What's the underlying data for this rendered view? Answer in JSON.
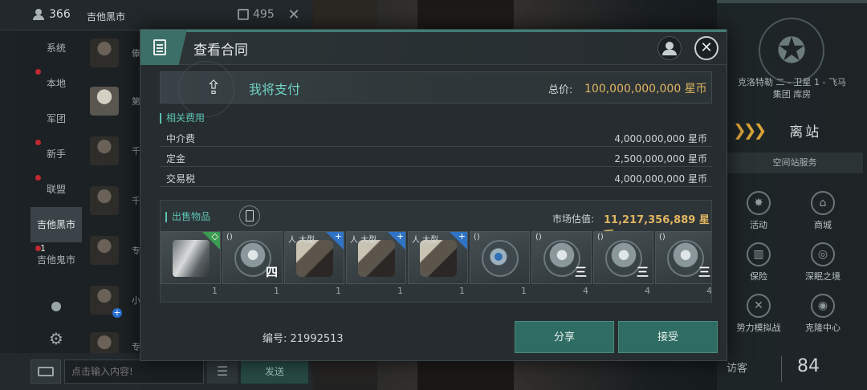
{
  "chat": {
    "online_count": "366",
    "channel_name": "吉他黑市",
    "member_count": "495",
    "tabs": [
      {
        "label": "系统",
        "dot": false
      },
      {
        "label": "本地",
        "dot": true
      },
      {
        "label": "军团",
        "dot": false
      },
      {
        "label": "新手",
        "dot": true
      },
      {
        "label": "联盟",
        "dot": true
      },
      {
        "label": "吉他黑市",
        "dot": false,
        "active": true
      },
      {
        "label": "吉他鬼市",
        "dot": true,
        "badge": "1"
      }
    ],
    "avatar_names": [
      "傣",
      "第",
      "千",
      "千",
      "专",
      "小",
      "专"
    ],
    "input_placeholder": "点击输入内容!",
    "send_label": "发送"
  },
  "modal": {
    "title": "查看合同",
    "pay_label": "我将支付",
    "total_label": "总价:",
    "total_value": "100,000,000,000 星币",
    "fees_title": "相关费用",
    "fees": [
      {
        "label": "中介费",
        "value": "4,000,000,000 星币"
      },
      {
        "label": "定金",
        "value": "2,500,000,000 星币"
      },
      {
        "label": "交易税",
        "value": "4,000,000,000 星币"
      }
    ],
    "items_title": "出售物品",
    "market_label": "市场估值:",
    "market_value": "11,217,356,889 星币",
    "items": [
      {
        "art": "drone",
        "tag": "",
        "flag": "green",
        "flag_glyph": "◇",
        "tier": "",
        "count": "1"
      },
      {
        "art": "shield",
        "tag": "()",
        "flag": "",
        "flag_glyph": "",
        "tier": "四",
        "count": "1"
      },
      {
        "art": "gun",
        "tag": "人 大型",
        "flag": "blue",
        "flag_glyph": "+",
        "tier": "",
        "count": "1"
      },
      {
        "art": "gun",
        "tag": "人 大型",
        "flag": "blue",
        "flag_glyph": "+",
        "tier": "",
        "count": "1"
      },
      {
        "art": "gun",
        "tag": "人 大型",
        "flag": "blue",
        "flag_glyph": "+",
        "tier": "",
        "count": "1"
      },
      {
        "art": "orb",
        "tag": "()",
        "flag": "",
        "flag_glyph": "",
        "tier": "",
        "count": "1"
      },
      {
        "art": "shield",
        "tag": "()",
        "flag": "",
        "flag_glyph": "",
        "tier": "三",
        "count": "4"
      },
      {
        "art": "shield",
        "tag": "()",
        "flag": "",
        "flag_glyph": "",
        "tier": "三",
        "count": "4"
      },
      {
        "art": "shield",
        "tag": "()",
        "flag": "",
        "flag_glyph": "",
        "tier": "三",
        "count": "4"
      }
    ],
    "contract_no": "编号: 21992513",
    "share_label": "分享",
    "accept_label": "接受"
  },
  "station": {
    "name_line1": "克洛特勒 二 - 卫星 1 - 飞马",
    "name_line2": "集团 库房",
    "undock_label": "离站",
    "services_title": "空间站服务",
    "services": [
      "活动",
      "商城",
      "保险",
      "深眠之境",
      "势力模拟战",
      "克隆中心"
    ],
    "visitors_label": "访客",
    "visitors_count": "84"
  },
  "colors": {
    "accent": "#5cc2b1",
    "price": "#e0b562",
    "button": "#2f6c63"
  }
}
